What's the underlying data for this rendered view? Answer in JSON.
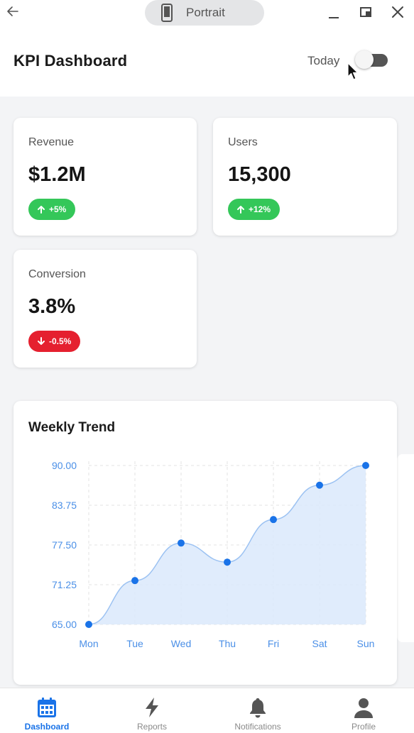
{
  "window": {
    "orientation_label": "Portrait",
    "back_icon": "arrow-left-icon",
    "controls": [
      "minimize-icon",
      "restore-icon",
      "close-icon"
    ]
  },
  "header": {
    "title": "KPI Dashboard",
    "toggle_label": "Today",
    "toggle_on": true
  },
  "kpis": [
    {
      "label": "Revenue",
      "value": "$1.2M",
      "delta": "+5%",
      "trend": "up",
      "color": "#34c759"
    },
    {
      "label": "Users",
      "value": "15,300",
      "delta": "+12%",
      "trend": "up",
      "color": "#34c759"
    },
    {
      "label": "Conversion",
      "value": "3.8%",
      "delta": "-0.5%",
      "trend": "down",
      "color": "#e5202f"
    }
  ],
  "chart": {
    "title": "Weekly Trend"
  },
  "chart_data": {
    "type": "area",
    "title": "Weekly Trend",
    "categories": [
      "Mon",
      "Tue",
      "Wed",
      "Thu",
      "Fri",
      "Sat",
      "Sun"
    ],
    "values": [
      65.0,
      71.9,
      77.8,
      74.8,
      81.5,
      86.9,
      90.0
    ],
    "yticks": [
      "90.00",
      "83.75",
      "77.50",
      "71.25",
      "65.00"
    ],
    "ylim": [
      65,
      90
    ],
    "grid": true,
    "line_color": "#1a73e8",
    "fill_color": "#dbe9fb",
    "label_color": "#4a8fe7"
  },
  "nav": {
    "items": [
      {
        "label": "Dashboard",
        "icon": "calendar-icon",
        "active": true
      },
      {
        "label": "Reports",
        "icon": "lightning-icon",
        "active": false
      },
      {
        "label": "Notifications",
        "icon": "bell-icon",
        "active": false
      },
      {
        "label": "Profile",
        "icon": "person-icon",
        "active": false
      }
    ]
  }
}
